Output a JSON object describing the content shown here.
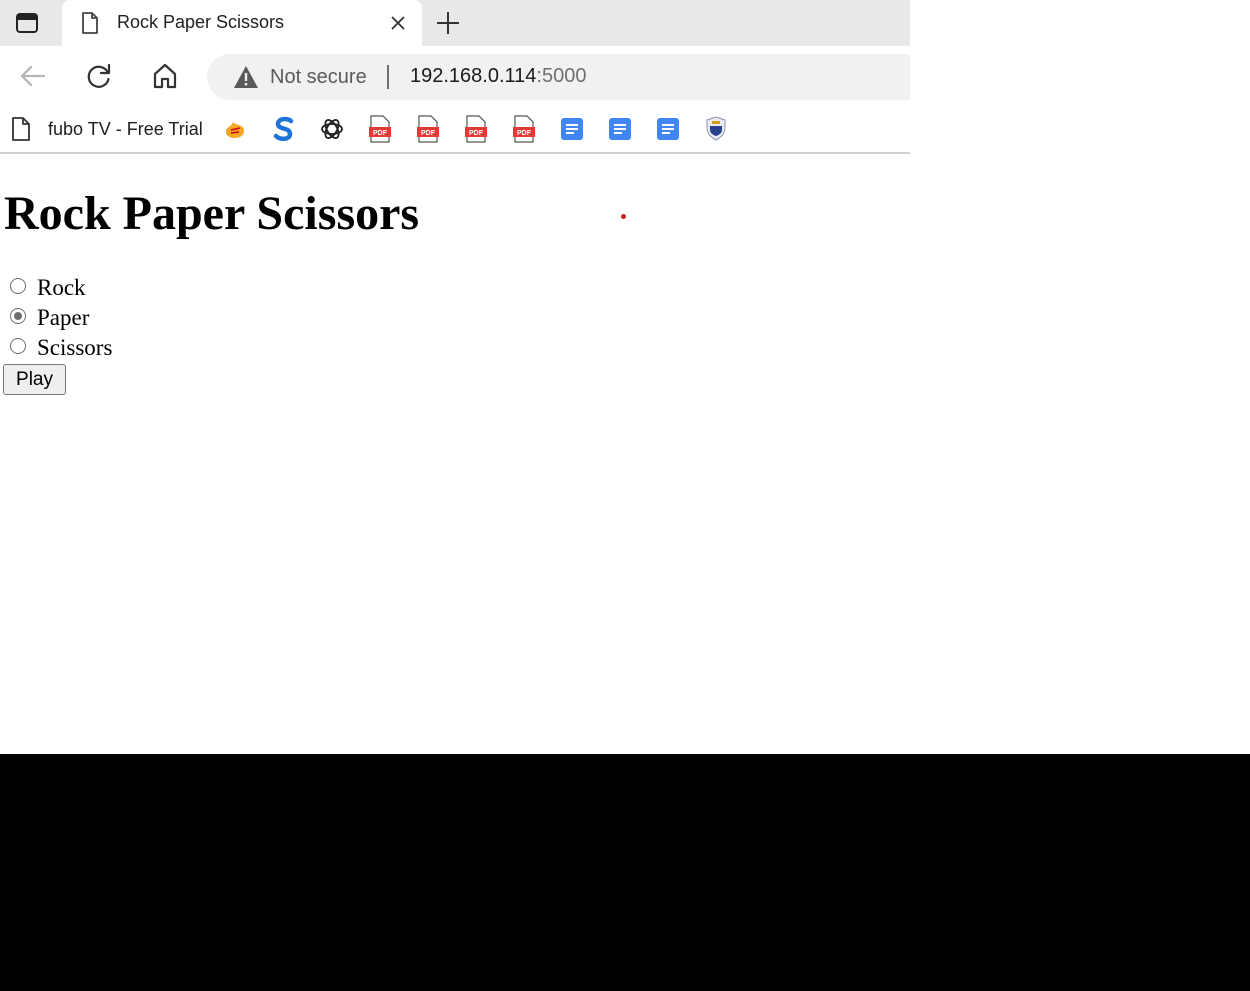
{
  "tab": {
    "title": "Rock Paper Scissors"
  },
  "toolbar": {
    "security_label": "Not secure",
    "url_host": "192.168.0.114",
    "url_port": ":5000"
  },
  "bookmarks": {
    "first_label": "fubo TV - Free Trial",
    "icons": [
      "fire-icon",
      "s-logo-icon",
      "openai-icon",
      "pdf-icon",
      "pdf-icon",
      "pdf-icon",
      "pdf-icon",
      "docs-icon",
      "docs-icon",
      "docs-icon",
      "shield-crest-icon"
    ]
  },
  "page": {
    "heading": "Rock Paper Scissors",
    "options": [
      {
        "label": "Rock",
        "checked": false
      },
      {
        "label": "Paper",
        "checked": true
      },
      {
        "label": "Scissors",
        "checked": false
      }
    ],
    "play_label": "Play"
  },
  "colors": {
    "pdf_red": "#e53935",
    "docs_blue": "#4285f4",
    "dot_red": "#cc1e1e"
  }
}
